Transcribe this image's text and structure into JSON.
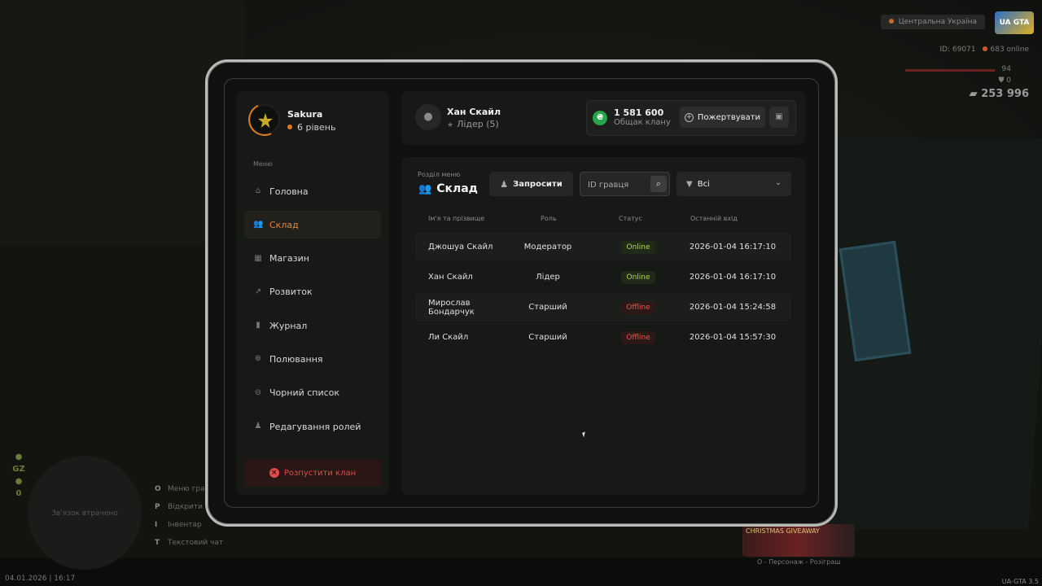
{
  "hud": {
    "region": "Центральна Україна",
    "logo": "UA GTA",
    "id_text": "ID: 69071",
    "online_text": "683 online",
    "health": "94",
    "armor": "0",
    "money": "253 996",
    "left_stats": [
      "GZ",
      "0"
    ],
    "zone_text": "Зв'язок втрачено",
    "hints": [
      {
        "key": "O",
        "label": "Меню гра"
      },
      {
        "key": "P",
        "label": "Відкрити"
      },
      {
        "key": "I",
        "label": "Інвентар"
      },
      {
        "key": "T",
        "label": "Текстовий чат"
      }
    ],
    "datetime": "04.01.2026 | 16:17",
    "version": "UA-GTA 3.5",
    "promo_title": "CHRISTMAS GIVEAWAY",
    "promo_sub": "O - Персонаж - Розіграш"
  },
  "profile": {
    "name": "Sakura",
    "level": "6 рівень"
  },
  "menu_label": "Меню",
  "nav": [
    {
      "label": "Головна",
      "icon": "home-icon",
      "glyph": "⌂"
    },
    {
      "label": "Склад",
      "icon": "people-icon",
      "glyph": "👥"
    },
    {
      "label": "Магазин",
      "icon": "shop-icon",
      "glyph": "▦"
    },
    {
      "label": "Розвиток",
      "icon": "chart-icon",
      "glyph": "↗"
    },
    {
      "label": "Журнал",
      "icon": "book-icon",
      "glyph": "▮"
    },
    {
      "label": "Полювання",
      "icon": "crosshair-icon",
      "glyph": "⊕"
    },
    {
      "label": "Чорний список",
      "icon": "minus-circle-icon",
      "glyph": "⊖"
    },
    {
      "label": "Редагування ролей",
      "icon": "user-edit-icon",
      "glyph": "♟"
    }
  ],
  "dissolve_label": "Розпустити клан",
  "leader": {
    "name": "Хан Скайл",
    "role": "Лідер (5)"
  },
  "fund": {
    "value": "1 581 600",
    "label": "Общак клану"
  },
  "donate_label": "Пожертвувати",
  "section": {
    "label": "Розділ меню",
    "title": "Склад"
  },
  "invite_label": "Запросити",
  "search": {
    "placeholder": "ID гравця"
  },
  "filter": {
    "selected": "Всі"
  },
  "table": {
    "headers": [
      "Ім'я та прізвище",
      "Роль",
      "Статус",
      "Останній вхід"
    ],
    "rows": [
      {
        "name": "Джошуа Скайл",
        "role": "Модератор",
        "status": "Online",
        "last": "2026-01-04 16:17:10"
      },
      {
        "name": "Хан Скайл",
        "role": "Лідер",
        "status": "Online",
        "last": "2026-01-04 16:17:10"
      },
      {
        "name": "Мирослав Бондарчук",
        "role": "Старший",
        "status": "Offline",
        "last": "2026-01-04 15:24:58"
      },
      {
        "name": "Ли Скайл",
        "role": "Старший",
        "status": "Offline",
        "last": "2026-01-04 15:57:30"
      }
    ]
  },
  "colors": {
    "accent": "#e8853a",
    "online": "#b5d84a",
    "offline": "#e35a4a",
    "fund": "#27a54a"
  }
}
